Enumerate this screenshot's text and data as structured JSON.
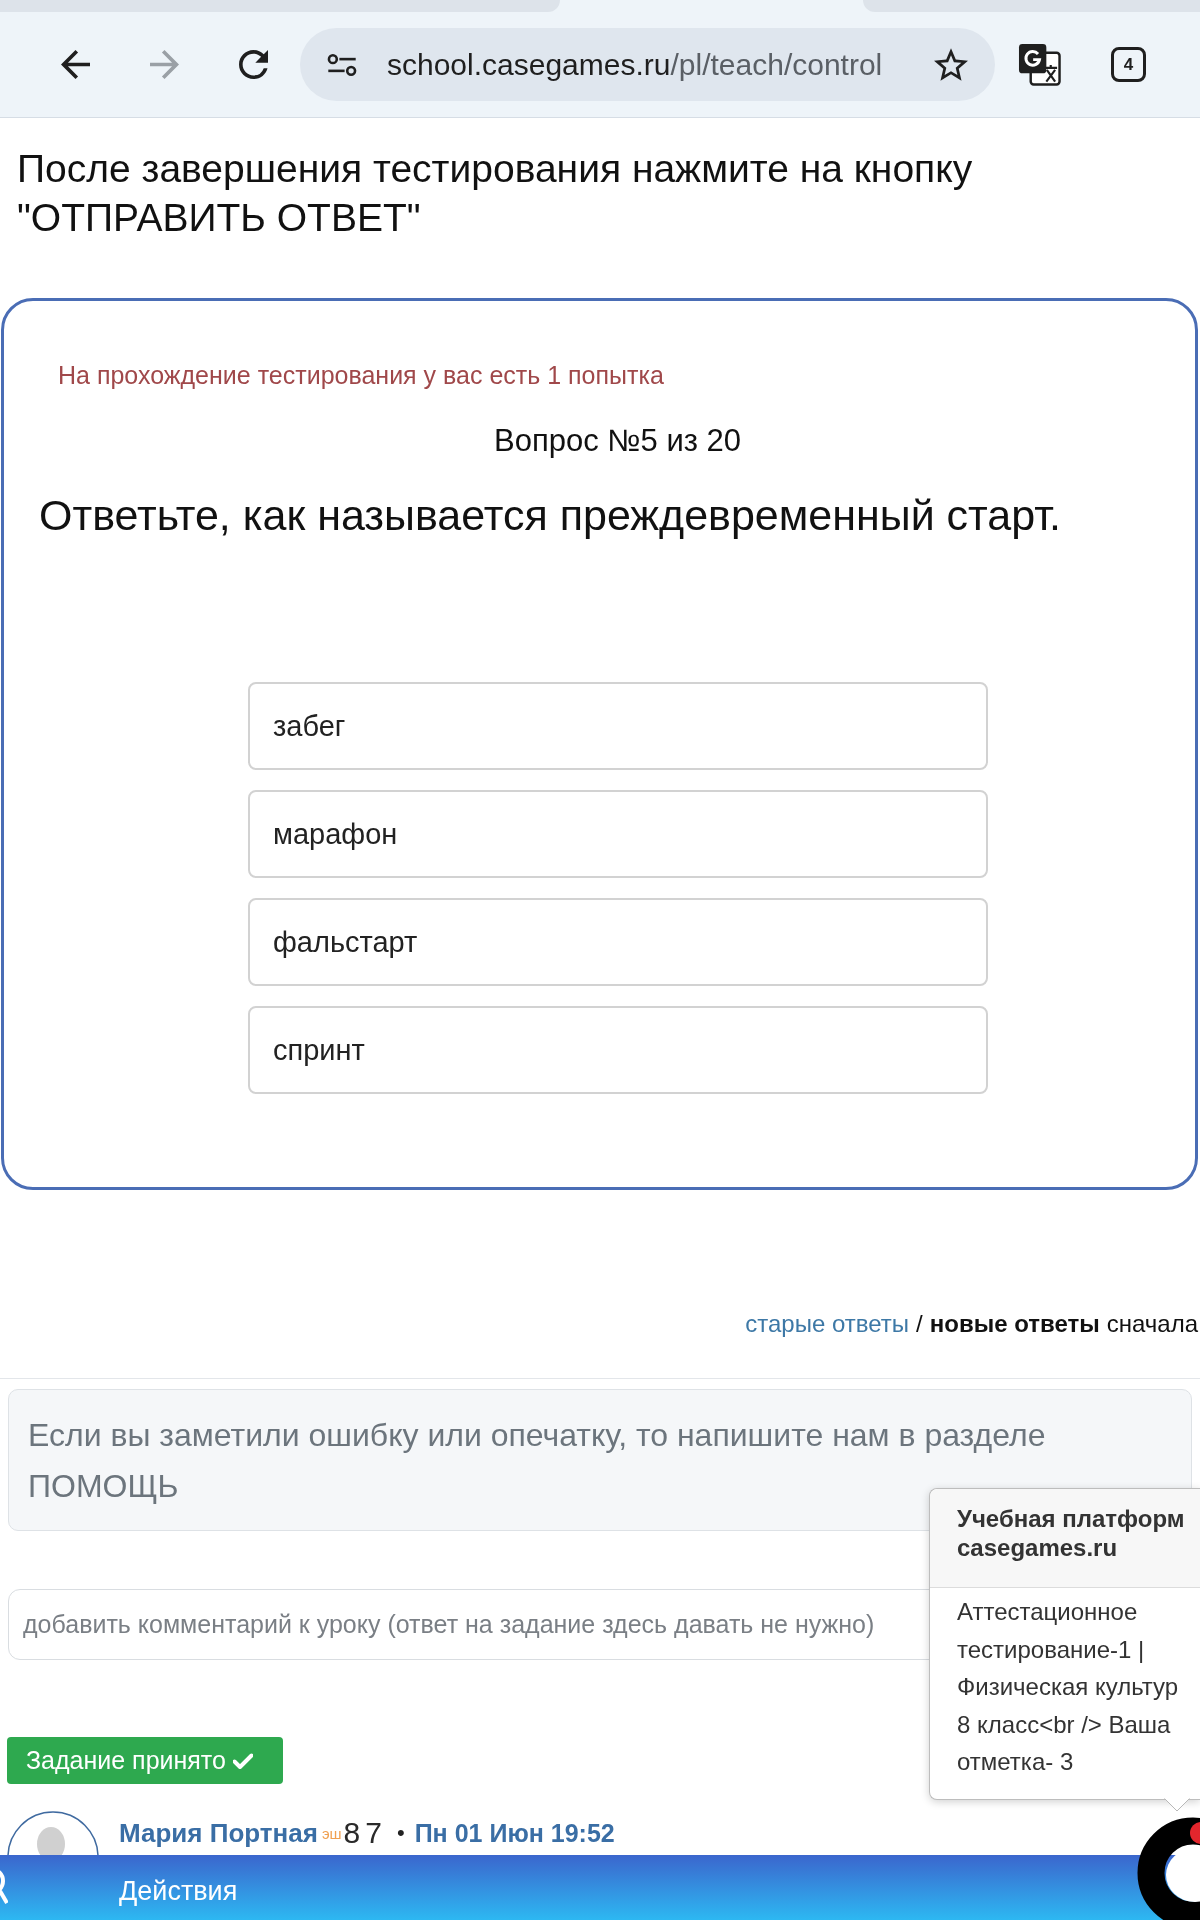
{
  "browser": {
    "nav_buttons": [
      {
        "kind": "back",
        "disabled": false
      },
      {
        "kind": "forward",
        "disabled": true
      },
      {
        "kind": "reload",
        "disabled": false
      }
    ],
    "address_bar": {
      "host": "school.casegames.ru",
      "path": "/pl/teach/control",
      "bookmarked": false
    },
    "tab_count": "4"
  },
  "instruction": "После завершения тестирования нажмите на кнопку \"ОТПРАВИТЬ ОТВЕТ\"",
  "quiz": {
    "attempts_note": "На прохождение тестирования у вас есть 1 попытка",
    "progress": "Вопрос №5 из 20",
    "question": "Ответьте, как называется преждевременный старт.",
    "options": [
      {
        "label": "забег",
        "selected": false
      },
      {
        "label": "марафон",
        "selected": false
      },
      {
        "label": "фальстарт",
        "selected": false
      },
      {
        "label": "спринт",
        "selected": false
      }
    ]
  },
  "answers_sort": {
    "options": [
      {
        "label": "старые ответы",
        "selected": false
      },
      {
        "label": "новые ответы",
        "selected": true
      }
    ],
    "separator": "/",
    "suffix": "сначала"
  },
  "notice": "Если вы заметили ошибку или опечатку, то напишите нам в разделе ПОМОЩЬ",
  "comment_field": {
    "placeholder": "добавить комментарий к уроку (ответ на задание здесь давать не нужно)"
  },
  "status_badge": {
    "label": "Задание принято"
  },
  "comment": {
    "author": "Мария Портная",
    "rank_prefix": "эш",
    "rank_number": "87",
    "separator": "•",
    "date": "Пн 01 Июн 19:52"
  },
  "bottom_bar": {
    "label": "Действия"
  },
  "notification": {
    "title": "Учебная платформ casegames.ru",
    "body": "Аттестационное тестирование-1 | Физическая культур 8 класс<br /> Ваша отметка- 3"
  }
}
